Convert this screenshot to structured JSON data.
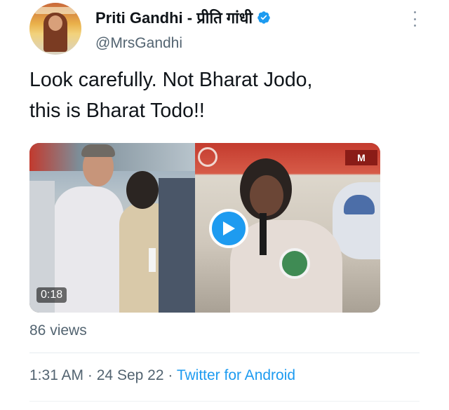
{
  "tweet": {
    "author": {
      "display_name": "Priti Gandhi - प्रीति गांधी",
      "handle": "@MrsGandhi",
      "verified": true
    },
    "text_lines": [
      "Look carefully. Not Bharat Jodo,",
      "this is Bharat Todo!!"
    ],
    "media": {
      "duration": "0:18",
      "watermark": "M"
    },
    "views": "86 views",
    "timestamp": "1:31 AM",
    "date": "24 Sep 22",
    "source": "Twitter for Android",
    "separator": "·"
  },
  "colors": {
    "accent": "#1d9bf0",
    "text_primary": "#0f1419",
    "text_secondary": "#536471"
  },
  "icons": {
    "verified": "verified-badge-icon",
    "more": "more-options-icon",
    "play": "play-icon"
  }
}
